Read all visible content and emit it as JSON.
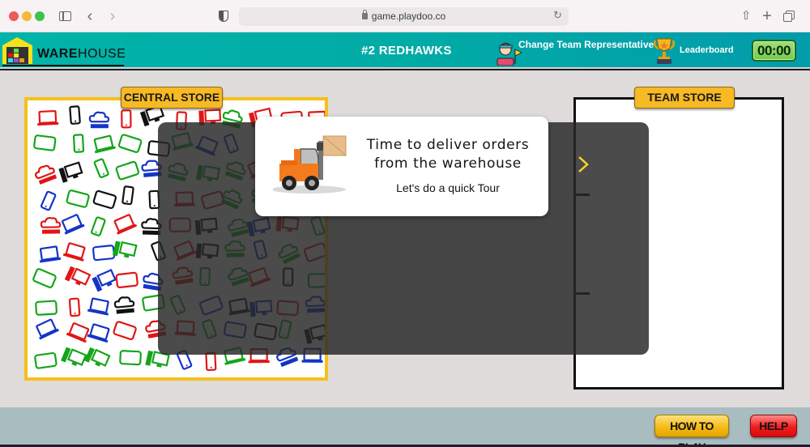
{
  "browser": {
    "url": "game.playdoo.co",
    "icons": [
      "sidebar-icon",
      "back-icon",
      "forward-icon",
      "privacy-shield-icon",
      "lock-icon",
      "reload-icon",
      "share-icon",
      "new-tab-icon",
      "tabs-overview-icon"
    ]
  },
  "header": {
    "logo_bold": "WARE",
    "logo_regular": "HOUSE",
    "team_name": "#2 REDHAWKS",
    "change_rep_label": "Change Team Representative",
    "leaderboard_label": "Leaderboard",
    "timer": "00:00"
  },
  "stores": {
    "central_label": "CENTRAL STORE",
    "team_label": "TEAM STORE",
    "item_colors": {
      "red": "#e01616",
      "green": "#14a51a",
      "blue": "#1434c8",
      "black": "#111111"
    },
    "item_types": [
      "cloud-server-icon",
      "laptop-icon",
      "phone-icon",
      "tablet-icon",
      "desktop-icon"
    ]
  },
  "tour": {
    "title_line1": "Time to deliver orders",
    "title_line2": "from the warehouse",
    "subtitle": "Let's do a quick Tour",
    "next_icon": "chevron-right-icon"
  },
  "footer": {
    "how_to_play": "HOW TO PLAY",
    "help": "HELP"
  },
  "colors": {
    "header_teal": "#01b4a9",
    "label_yellow": "#f7b924",
    "timer_green": "#7fd15a",
    "help_red": "#f21c1c",
    "chevron_yellow": "#f5d72a"
  }
}
